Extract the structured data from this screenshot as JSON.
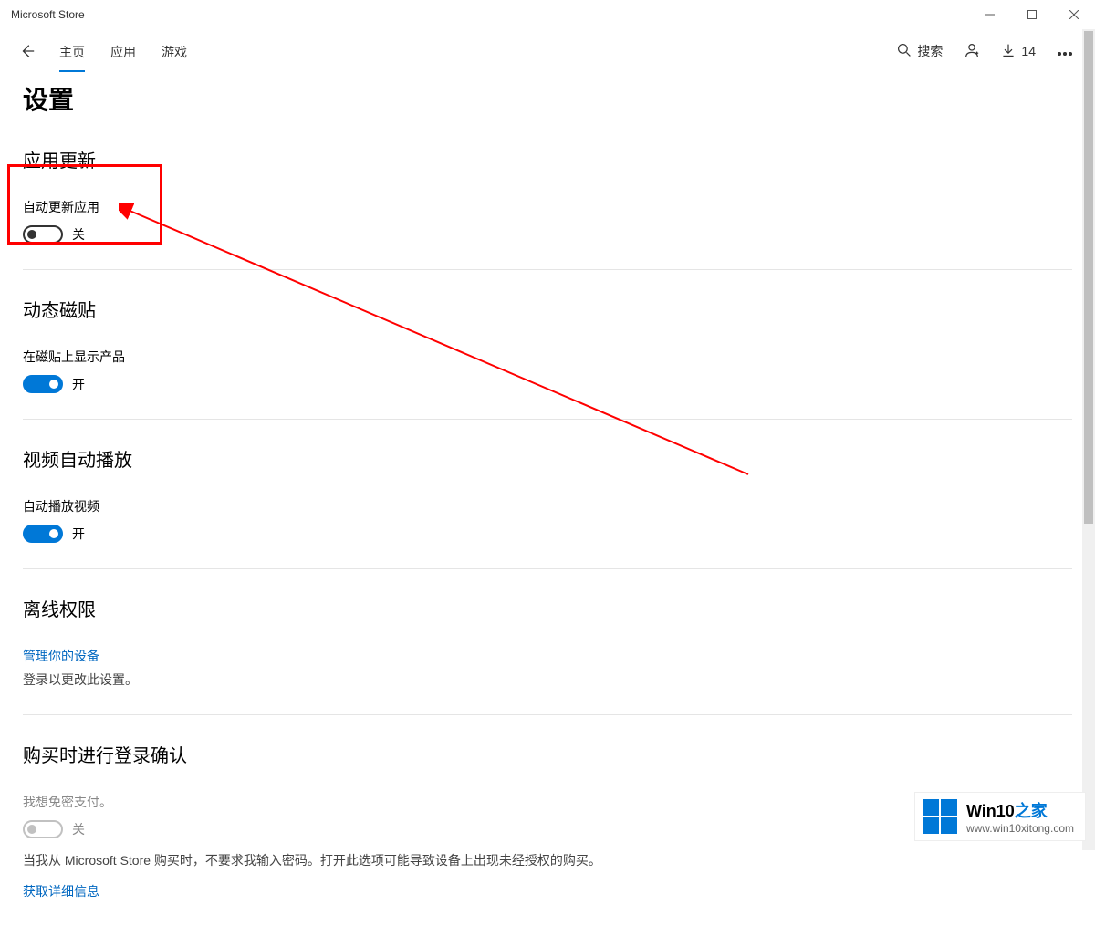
{
  "window": {
    "title": "Microsoft Store"
  },
  "header": {
    "tabs": {
      "home": "主页",
      "apps": "应用",
      "games": "游戏"
    },
    "search_label": "搜索",
    "downloads_count": "14"
  },
  "page": {
    "title": "设置"
  },
  "sections": {
    "app_updates": {
      "title": "应用更新",
      "label": "自动更新应用",
      "state_text": "关"
    },
    "live_tile": {
      "title": "动态磁贴",
      "label": "在磁贴上显示产品",
      "state_text": "开"
    },
    "video_autoplay": {
      "title": "视频自动播放",
      "label": "自动播放视频",
      "state_text": "开"
    },
    "offline": {
      "title": "离线权限",
      "link": "管理你的设备",
      "note": "登录以更改此设置。"
    },
    "purchase": {
      "title": "购买时进行登录确认",
      "label": "我想免密支付。",
      "state_text": "关",
      "note": "当我从 Microsoft Store 购买时，不要求我输入密码。打开此选项可能导致设备上出现未经授权的购买。",
      "link": "获取详细信息"
    }
  },
  "watermark": {
    "brand_main": "Win10",
    "brand_accent": "之家",
    "url": "www.win10xitong.com"
  }
}
